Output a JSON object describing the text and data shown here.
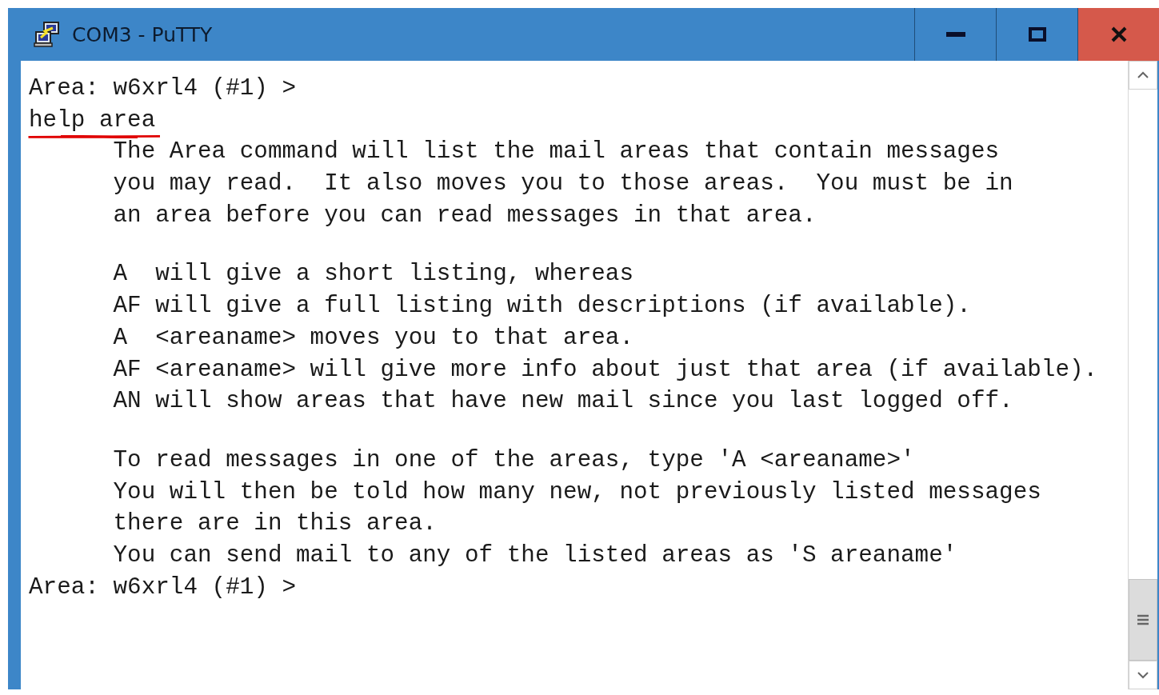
{
  "window": {
    "title": "COM3 - PuTTY"
  },
  "terminal": {
    "paragraphs": [
      [
        "Area: w6xrl4 (#1) >",
        "help area",
        "      The Area command will list the mail areas that contain messages",
        "      you may read.  It also moves you to those areas.  You must be in",
        "      an area before you can read messages in that area."
      ],
      [
        "      A  will give a short listing, whereas",
        "      AF will give a full listing with descriptions (if available).",
        "      A  <areaname> moves you to that area.",
        "      AF <areaname> will give more info about just that area (if available).",
        "      AN will show areas that have new mail since you last logged off."
      ],
      [
        "      To read messages in one of the areas, type 'A <areaname>'",
        "      You will then be told how many new, not previously listed messages",
        "      there are in this area.",
        "      You can send mail to any of the listed areas as 'S areaname'",
        "Area: w6xrl4 (#1) >"
      ]
    ]
  }
}
